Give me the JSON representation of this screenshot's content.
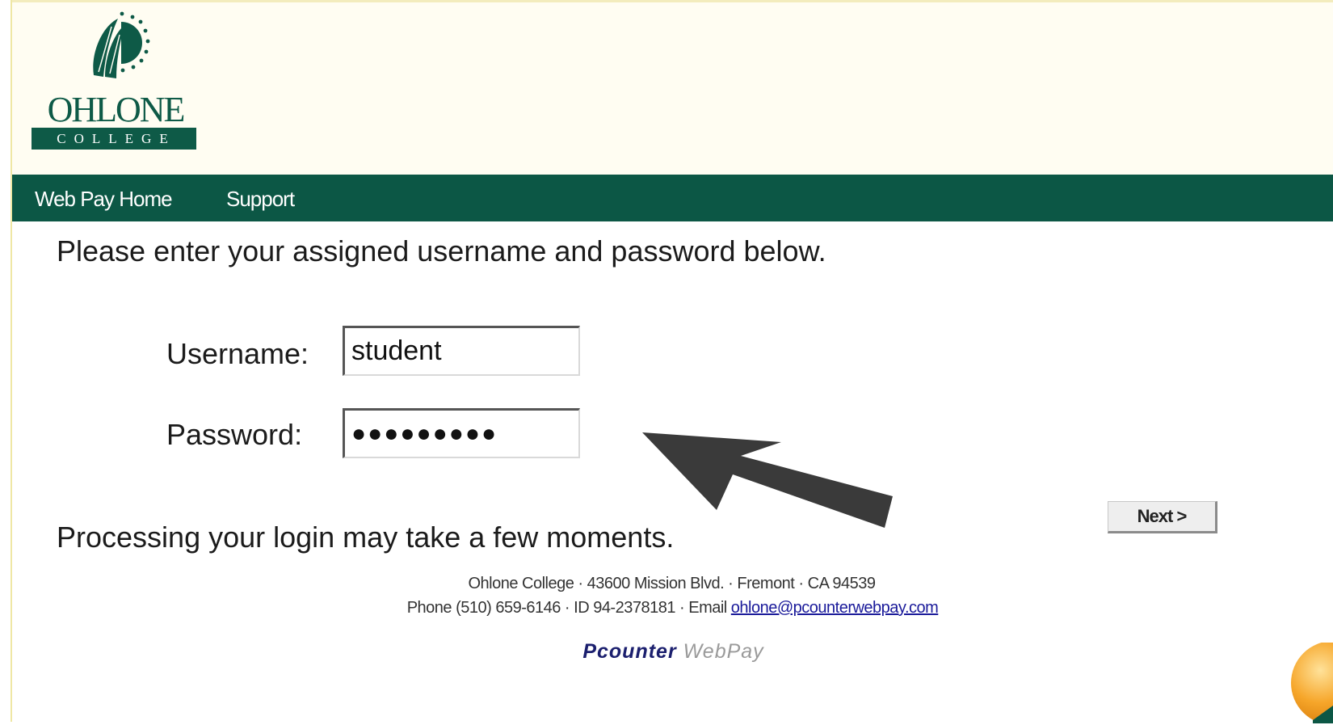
{
  "header": {
    "logo_word": "OHLONE",
    "logo_sub": "COLLEGE"
  },
  "nav": {
    "home": "Web Pay Home",
    "support": "Support"
  },
  "form": {
    "intro": "Please enter your assigned username and password below.",
    "username_label": "Username:",
    "username_value": "student",
    "password_label": "Password:",
    "password_value": "●●●●●●●●●",
    "next_label": "Next >",
    "processing_note": "Processing your login may take a few moments."
  },
  "footer": {
    "address": "Ohlone College · 43600 Mission Blvd. · Fremont · CA 94539",
    "contact": "Phone (510) 659-6146 · ID 94-2378181 · Email ",
    "email": "ohlone@pcounterwebpay.com",
    "brand_bold": "Pcounter",
    "brand_light": "WebPay"
  },
  "colors": {
    "brand_green": "#0c5745",
    "header_bg": "#fffdf2",
    "annotation_arrow": "#3a3a3a"
  },
  "icons": {
    "logo": "ohlone-sun-feather-logo",
    "annotation": "annotation-arrow-icon"
  }
}
